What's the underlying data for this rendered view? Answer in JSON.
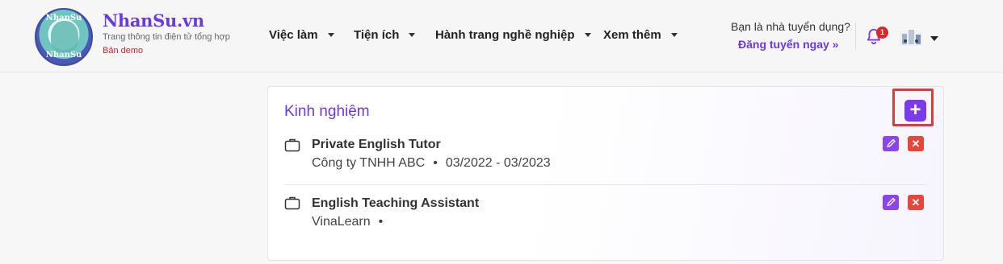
{
  "header": {
    "logo": {
      "top_text": "NhanSu",
      "bottom_text": "NhanSu"
    },
    "brand": "NhanSu.vn",
    "tagline": "Trang thông tin điện tử tổng hợp",
    "demo_label": "Bản demo",
    "nav": [
      {
        "label": "Việc làm"
      },
      {
        "label": "Tiện ích"
      },
      {
        "label": "Hành trang nghề nghiệp"
      },
      {
        "label": "Xem thêm"
      }
    ],
    "recruiter_question": "Bạn là nhà tuyển dụng?",
    "post_job_link": "Đăng tuyển ngay »",
    "notification_count": "1",
    "accent_color": "#6a39e6"
  },
  "experience": {
    "title": "Kinh nghiệm",
    "add_icon": "+",
    "items": [
      {
        "title": "Private English Tutor",
        "company": "Công ty TNHH ABC",
        "separator": "•",
        "period": "03/2022 - 03/2023"
      },
      {
        "title": "English Teaching Assistant",
        "company": "VinaLearn",
        "separator": "•",
        "period": ""
      }
    ],
    "delete_icon": "✕"
  }
}
